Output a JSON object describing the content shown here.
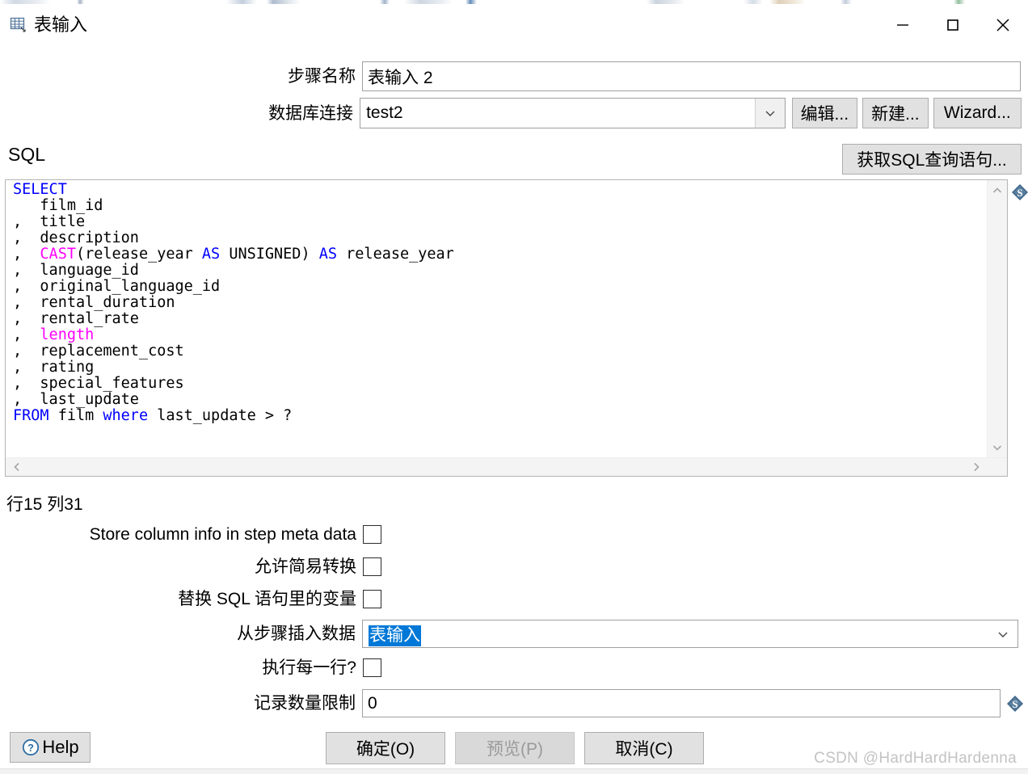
{
  "window": {
    "title": "表输入",
    "icon": "table-input-icon",
    "controls": {
      "minimize": "—",
      "maximize": "□",
      "close": "✕"
    }
  },
  "form": {
    "step_name": {
      "label": "步骤名称",
      "value": "表输入 2"
    },
    "db_connection": {
      "label": "数据库连接",
      "value": "test2",
      "buttons": [
        {
          "label": "编辑...",
          "name": "edit-connection-button"
        },
        {
          "label": "新建...",
          "name": "new-connection-button"
        },
        {
          "label": "Wizard...",
          "name": "wizard-button"
        }
      ]
    }
  },
  "sql": {
    "section_label": "SQL",
    "get_sql_button": "获取SQL查询语句...",
    "variable_icon": "dollar-variable-icon",
    "status": "行15 列31",
    "lines": [
      {
        "segments": [
          {
            "t": "SELECT",
            "c": "blue"
          }
        ]
      },
      {
        "segments": [
          {
            "t": "   film_id",
            "c": ""
          }
        ]
      },
      {
        "segments": [
          {
            "t": ",  title",
            "c": ""
          }
        ]
      },
      {
        "segments": [
          {
            "t": ",  description",
            "c": ""
          }
        ]
      },
      {
        "segments": [
          {
            "t": ",  ",
            "c": ""
          },
          {
            "t": "CAST",
            "c": "pink"
          },
          {
            "t": "(release_year ",
            "c": ""
          },
          {
            "t": "AS",
            "c": "blue"
          },
          {
            "t": " UNSIGNED) ",
            "c": ""
          },
          {
            "t": "AS",
            "c": "blue"
          },
          {
            "t": " release_year",
            "c": ""
          }
        ]
      },
      {
        "segments": [
          {
            "t": ",  language_id",
            "c": ""
          }
        ]
      },
      {
        "segments": [
          {
            "t": ",  original_language_id",
            "c": ""
          }
        ]
      },
      {
        "segments": [
          {
            "t": ",  rental_duration",
            "c": ""
          }
        ]
      },
      {
        "segments": [
          {
            "t": ",  rental_rate",
            "c": ""
          }
        ]
      },
      {
        "segments": [
          {
            "t": ",  ",
            "c": ""
          },
          {
            "t": "length",
            "c": "pink"
          }
        ]
      },
      {
        "segments": [
          {
            "t": ",  replacement_cost",
            "c": ""
          }
        ]
      },
      {
        "segments": [
          {
            "t": ",  rating",
            "c": ""
          }
        ]
      },
      {
        "segments": [
          {
            "t": ",  special_features",
            "c": ""
          }
        ]
      },
      {
        "segments": [
          {
            "t": ",  last_update",
            "c": ""
          }
        ]
      },
      {
        "segments": [
          {
            "t": "FROM",
            "c": "blue"
          },
          {
            "t": " film ",
            "c": ""
          },
          {
            "t": "where",
            "c": "blue"
          },
          {
            "t": " last_update > ?",
            "c": ""
          }
        ]
      }
    ]
  },
  "options": {
    "store_column_info": {
      "label": "Store column info in step meta data",
      "checked": false
    },
    "allow_lazy_conversion": {
      "label": "允许简易转换",
      "checked": false
    },
    "replace_variables": {
      "label": "替换 SQL 语句里的变量",
      "checked": false
    },
    "insert_data_from_step": {
      "label": "从步骤插入数据",
      "value": "表输入"
    },
    "execute_each_row": {
      "label": "执行每一行?",
      "checked": false
    },
    "limit_size": {
      "label": "记录数量限制",
      "value": "0",
      "variable_icon": "dollar-variable-icon"
    }
  },
  "footer": {
    "help": "Help",
    "help_icon": "question-mark-icon",
    "ok": "确定(O)",
    "preview": "预览(P)",
    "preview_disabled": true,
    "cancel": "取消(C)"
  },
  "watermark": "CSDN @HardHardHardenna",
  "colors": {
    "keyword_blue": "#0000ff",
    "keyword_pink": "#ff00ff",
    "selection_blue": "#0078d7",
    "button_face": "#e1e1e1",
    "variable_icon_blue": "#40688c"
  }
}
